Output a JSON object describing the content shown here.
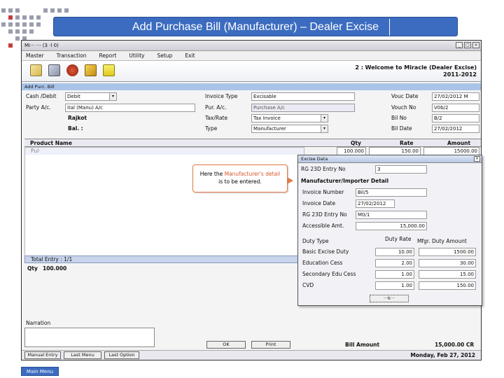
{
  "slide": {
    "title": "Add Purchase Bill (Manufacturer) – Dealer Excise",
    "main_menu": "Main Menu"
  },
  "window": {
    "title": "Mi··· ··· (3 ·l 0)",
    "menu": [
      "Master",
      "Transaction",
      "Report",
      "Utility",
      "Setup",
      "Exit"
    ],
    "welcome_line1": "2 : Welcome to Miracle (Dealer Excise)",
    "welcome_line2": "2011-2012",
    "tools": [
      "copy-icon",
      "cart-icon",
      "money-bag-icon",
      "edit-icon",
      "help-icon"
    ]
  },
  "form": {
    "subtitle": "Add Purc. Bill",
    "cash_debit_label": "Cash /Debit",
    "cash_debit_value": "Debit",
    "party_label": "Party A/c.",
    "party_value": "ital (Manu) A/c",
    "city": "Rajkot",
    "bal_label": "Bal. :",
    "invoice_type_label": "Invoice Type",
    "invoice_type_value": "Excisable",
    "purc_ac_label": "Pur. A/c.",
    "purc_ac_value": "Purchase A/c",
    "tax_rate_label": "Tax/Rate",
    "tax_rate_value": "Tax Invoice",
    "type_label": "Type",
    "type_value": "Manufacturer",
    "vouc_date_label": "Vouc Date",
    "vouc_date_value": "27/02/2012 M",
    "vouc_no_label": "Vouch No",
    "vouc_no_value": "V0b/2",
    "bill_no_label": "Bil No",
    "bill_no_value": "B/2",
    "bill_date_label": "Bil Date",
    "bill_date_value": "27/02/2012"
  },
  "grid": {
    "headers": [
      "Product Name",
      "Qty",
      "Rate",
      "Amount"
    ],
    "rows": [
      {
        "product": "Pul·",
        "qty": "100.000",
        "rate": "150.00",
        "amount": "15000.00"
      }
    ],
    "total_entry": "Total Entry : 1/1",
    "qty_label": "Qty",
    "qty_total": "100.000"
  },
  "narration": {
    "label": "Narration"
  },
  "buttons": {
    "manual_entry": "Manual Entry",
    "last_menu": "Last Menu",
    "last_option": "Last Option",
    "ok": "OK",
    "print": "Print"
  },
  "footer": {
    "bill_amount_label": "Bill Amount",
    "bill_amount_value": "15,000.00 CR",
    "date": "Monday, Feb 27, 2012"
  },
  "callout": {
    "line1_pre": "Here the ",
    "line1_highlight": "Manufacturer's detail",
    "line2": "is to be entered."
  },
  "excise_dialog": {
    "title": "Excise Data",
    "rg_entry_label": "RG 23D Entry No",
    "rg_entry_value": "3",
    "section_title": "Manufacturer/Importer Detail",
    "fields": [
      {
        "label": "Invoice Number",
        "value": "Bil/5"
      },
      {
        "label": "Invoice Date",
        "value": "27/02/2012"
      },
      {
        "label": "RG 23D Entry No",
        "value": "M0/1"
      },
      {
        "label": "Accessible Amt.",
        "value": "15,000.00"
      }
    ],
    "duty_headers": [
      "Duty Type",
      "Duty Rate",
      "Mfgr. Duty Amount"
    ],
    "duties": [
      {
        "name": "Basic Excise Duty",
        "rate": "10.00",
        "amount": "1500.00"
      },
      {
        "name": "Education Cess",
        "rate": "2.00",
        "amount": "30.00"
      },
      {
        "name": "Secondary Edu Cess",
        "rate": "1.00",
        "amount": "15.00"
      },
      {
        "name": "CVD",
        "rate": "1.00",
        "amount": "150.00"
      }
    ],
    "ok_label": "···k···"
  }
}
